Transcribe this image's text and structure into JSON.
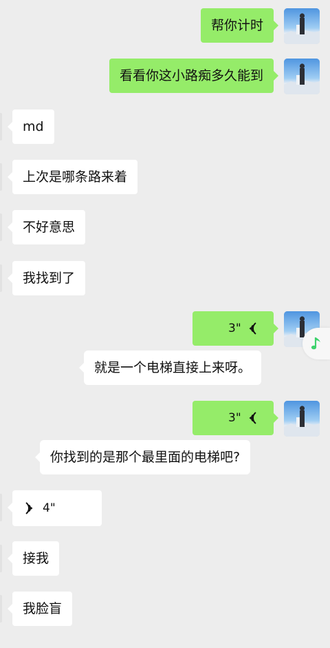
{
  "messages": [
    {
      "id": "m1",
      "from": "me",
      "type": "text",
      "text": "帮你计时"
    },
    {
      "id": "m2",
      "from": "me",
      "type": "text",
      "text": "看看你这小路痴多久能到"
    },
    {
      "id": "m3",
      "from": "other",
      "type": "text",
      "text": "md"
    },
    {
      "id": "m4",
      "from": "other",
      "type": "text",
      "text": "上次是哪条路来着"
    },
    {
      "id": "m5",
      "from": "other",
      "type": "text",
      "text": "不好意思"
    },
    {
      "id": "m6",
      "from": "other",
      "type": "text",
      "text": "我找到了"
    },
    {
      "id": "m7",
      "from": "me",
      "type": "voice",
      "duration": "3\""
    },
    {
      "id": "m7t",
      "from": "me",
      "type": "transcript",
      "text": "就是一个电梯直接上来呀。"
    },
    {
      "id": "m8",
      "from": "me",
      "type": "voice",
      "duration": "3\""
    },
    {
      "id": "m8t",
      "from": "me",
      "type": "transcript",
      "text": "你找到的是那个最里面的电梯吧?"
    },
    {
      "id": "m9",
      "from": "other",
      "type": "voice",
      "duration": "4\""
    },
    {
      "id": "m10",
      "from": "other",
      "type": "text",
      "text": "接我"
    },
    {
      "id": "m11",
      "from": "other",
      "type": "text",
      "text": "我脸盲"
    }
  ],
  "colors": {
    "background": "#ededed",
    "sent_bubble": "#95ec69",
    "received_bubble": "#ffffff",
    "music_icon": "#3dd26c"
  },
  "icons": {
    "avatar": "avatar-snow-mountain-person",
    "voice_sent": "voice-wave-icon",
    "voice_received": "voice-wave-icon",
    "floating": "music-note-icon"
  }
}
